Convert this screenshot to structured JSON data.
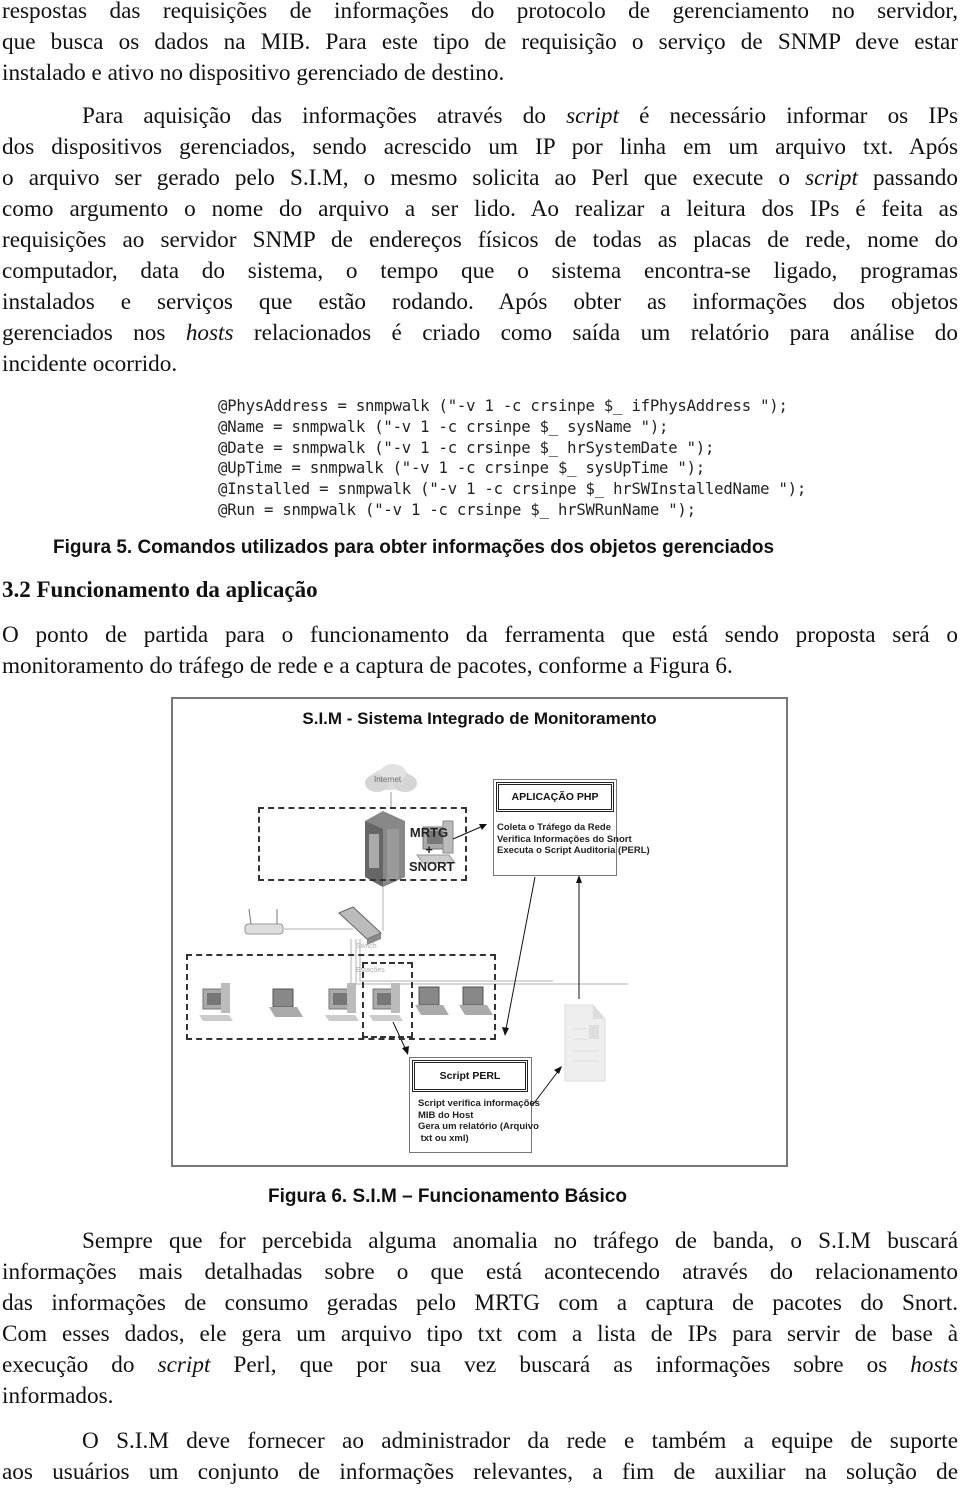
{
  "paragraph_intro": {
    "lines": [
      "respostas das requisições de informações do protocolo de gerenciamento no servidor,",
      "que busca os dados na MIB. Para este tipo de requisição o serviço de SNMP deve estar",
      "instalado e ativo no dispositivo gerenciado de destino."
    ]
  },
  "paragraph_script": {
    "line1_pre": "Para aquisição das informações através do ",
    "line1_em": "script",
    "line1_post": " é necessário informar os IPs",
    "line2": "dos dispositivos gerenciados, sendo acrescido um IP por linha em um arquivo txt. Após",
    "line3_pre": "o arquivo ser gerado pelo S.I.M, o mesmo solicita ao Perl que execute o ",
    "line3_em": "script",
    "line3_post": " passando",
    "line4": "como argumento o nome do arquivo a ser lido. Ao realizar a leitura dos IPs é feita as",
    "line5": "requisições ao servidor SNMP de endereços físicos de todas as placas de rede, nome do",
    "line6": "computador, data do sistema, o tempo que o sistema encontra-se ligado, programas",
    "line7": "instalados e serviços que estão rodando. Após obter as informações dos objetos",
    "line8_pre": "gerenciados nos ",
    "line8_em": "hosts",
    "line8_post": " relacionados é criado como saída um relatório para análise do",
    "line9": "incidente ocorrido."
  },
  "code_figure": {
    "lines": [
      "@PhysAddress = snmpwalk (\"-v 1 -c crsinpe $_ ifPhysAddress \");",
      "@Name = snmpwalk (\"-v 1 -c crsinpe $_ sysName \");",
      "@Date = snmpwalk (\"-v 1 -c crsinpe $_ hrSystemDate \");",
      "@UpTime = snmpwalk (\"-v 1 -c crsinpe $_ sysUpTime \");",
      "@Installed = snmpwalk (\"-v 1 -c crsinpe $_ hrSWInstalledName \");",
      "@Run = snmpwalk (\"-v 1 -c crsinpe $_ hrSWRunName \");"
    ],
    "caption": "Figura 5. Comandos utilizados para obter informações dos objetos gerenciados"
  },
  "section": {
    "heading": "3.2 Funcionamento da aplicação",
    "lines": [
      "O ponto de partida para o funcionamento da ferramenta que está sendo proposta será o",
      "monitoramento do tráfego de rede e a captura de pacotes, conforme a Figura 6."
    ]
  },
  "diagram": {
    "title": "S.I.M - Sistema Integrado de Monitoramento",
    "internet_label": "Internet",
    "server_label": [
      "MRTG",
      "+",
      "SNORT"
    ],
    "switch_label": "Switch",
    "stations_label": "Estações",
    "php_box": {
      "title": "APLICAÇÃO PHP",
      "lines": [
        "Coleta o Tráfego da Rede",
        "Verifica Informações do Snort",
        "Executa o Script Auditoria (PERL)"
      ]
    },
    "perl_box": {
      "title": "Script PERL",
      "lines": [
        "Script verifica informações",
        "MIB do Host",
        "Gera um relatório (Arquivo",
        " txt ou xml)"
      ]
    },
    "caption": "Figura 6. S.I.M – Funcionamento Básico"
  },
  "paragraph_anomaly": {
    "line1": "Sempre que for percebida alguma anomalia no tráfego de banda, o S.I.M buscará",
    "line2": "informações mais detalhadas sobre o que está acontecendo através do relacionamento",
    "line3": "das informações de consumo geradas pelo MRTG com a captura de pacotes do Snort.",
    "line4": "Com esses dados, ele gera um arquivo tipo txt com a lista de IPs para servir de base à",
    "line5_pre": "execução do ",
    "line5_em": "script",
    "line5_mid": " Perl, que por sua vez buscará as informações sobre os ",
    "line5_em2": "hosts",
    "line6": "informados."
  },
  "paragraph_final": {
    "line1": "O S.I.M deve fornecer ao administrador da rede e também a equipe de suporte",
    "line2": "aos usuários um conjunto de informações relevantes, a fim de auxiliar na solução de"
  }
}
